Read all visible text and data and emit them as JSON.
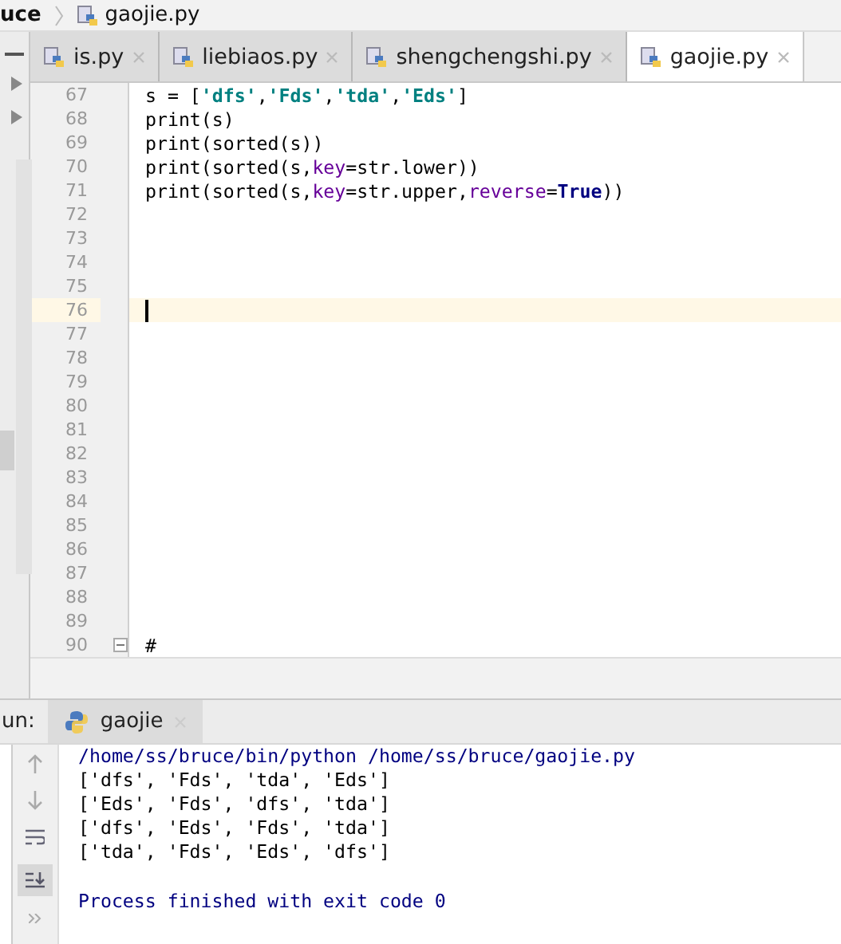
{
  "breadcrumb": [
    "uce",
    "gaojie.py"
  ],
  "tabs": [
    {
      "label": "is.py",
      "selected": false
    },
    {
      "label": "liebiaos.py",
      "selected": false
    },
    {
      "label": "shengchengshi.py",
      "selected": false
    },
    {
      "label": "gaojie.py",
      "selected": true
    }
  ],
  "editor": {
    "lines": [
      {
        "number": "67",
        "current": false,
        "fold": false,
        "tokens": [
          {
            "kind": "plain",
            "text": "s = ["
          },
          {
            "kind": "string",
            "text": "'dfs'"
          },
          {
            "kind": "plain",
            "text": ","
          },
          {
            "kind": "string",
            "text": "'Fds'"
          },
          {
            "kind": "plain",
            "text": ","
          },
          {
            "kind": "string",
            "text": "'tda'"
          },
          {
            "kind": "plain",
            "text": ","
          },
          {
            "kind": "string",
            "text": "'Eds'"
          },
          {
            "kind": "plain",
            "text": "]"
          }
        ]
      },
      {
        "number": "68",
        "current": false,
        "fold": false,
        "tokens": [
          {
            "kind": "plain",
            "text": "print(s)"
          }
        ]
      },
      {
        "number": "69",
        "current": false,
        "fold": false,
        "tokens": [
          {
            "kind": "plain",
            "text": "print(sorted(s))"
          }
        ]
      },
      {
        "number": "70",
        "current": false,
        "fold": false,
        "tokens": [
          {
            "kind": "plain",
            "text": "print(sorted(s,"
          },
          {
            "kind": "param",
            "text": "key"
          },
          {
            "kind": "plain",
            "text": "=str.lower))"
          }
        ]
      },
      {
        "number": "71",
        "current": false,
        "fold": false,
        "tokens": [
          {
            "kind": "plain",
            "text": "print(sorted(s,"
          },
          {
            "kind": "param",
            "text": "key"
          },
          {
            "kind": "plain",
            "text": "=str.upper,"
          },
          {
            "kind": "param",
            "text": "reverse"
          },
          {
            "kind": "plain",
            "text": "="
          },
          {
            "kind": "keyword",
            "text": "True"
          },
          {
            "kind": "plain",
            "text": "))"
          }
        ]
      },
      {
        "number": "72",
        "current": false,
        "fold": false
      },
      {
        "number": "73",
        "current": false,
        "fold": false
      },
      {
        "number": "74",
        "current": false,
        "fold": false
      },
      {
        "number": "75",
        "current": false,
        "fold": false
      },
      {
        "number": "76",
        "current": true,
        "fold": false
      },
      {
        "number": "77",
        "current": false,
        "fold": false
      },
      {
        "number": "78",
        "current": false,
        "fold": false
      },
      {
        "number": "79",
        "current": false,
        "fold": false
      },
      {
        "number": "80",
        "current": false,
        "fold": false
      },
      {
        "number": "81",
        "current": false,
        "fold": false
      },
      {
        "number": "82",
        "current": false,
        "fold": false
      },
      {
        "number": "83",
        "current": false,
        "fold": false
      },
      {
        "number": "84",
        "current": false,
        "fold": false
      },
      {
        "number": "85",
        "current": false,
        "fold": false
      },
      {
        "number": "86",
        "current": false,
        "fold": false
      },
      {
        "number": "87",
        "current": false,
        "fold": false
      },
      {
        "number": "88",
        "current": false,
        "fold": false
      },
      {
        "number": "89",
        "current": false,
        "fold": false
      },
      {
        "number": "90",
        "current": false,
        "fold": true,
        "tokens": [
          {
            "kind": "plain",
            "text": "#"
          }
        ]
      }
    ]
  },
  "run": {
    "label": "un:",
    "tab": "gaojie",
    "console": [
      {
        "kind": "command",
        "text": "/home/ss/bruce/bin/python /home/ss/bruce/gaojie.py"
      },
      {
        "kind": "output",
        "text": "['dfs', 'Fds', 'tda', 'Eds']"
      },
      {
        "kind": "output",
        "text": "['Eds', 'Fds', 'dfs', 'tda']"
      },
      {
        "kind": "output",
        "text": "['dfs', 'Eds', 'Fds', 'tda']"
      },
      {
        "kind": "output",
        "text": "['tda', 'Fds', 'Eds', 'dfs']"
      },
      {
        "kind": "exit",
        "text": "Process finished with exit code 0"
      }
    ]
  }
}
